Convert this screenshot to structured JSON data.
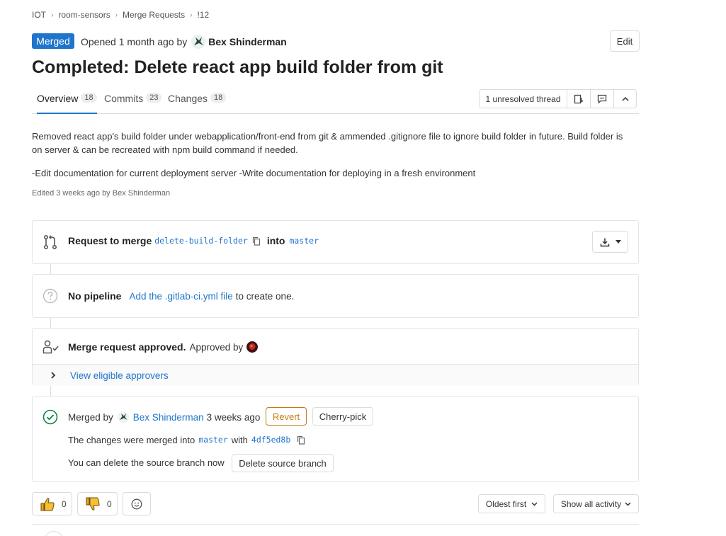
{
  "breadcrumb": {
    "items": [
      "IOT",
      "room-sensors",
      "Merge Requests",
      "!12"
    ]
  },
  "header": {
    "status": "Merged",
    "opened_text": "Opened",
    "opened_time": "1 month ago",
    "by_text": "by",
    "author": "Bex Shinderman",
    "edit_label": "Edit",
    "title": "Completed: Delete react app build folder from git"
  },
  "tabs": [
    {
      "label": "Overview",
      "count": "18"
    },
    {
      "label": "Commits",
      "count": "23"
    },
    {
      "label": "Changes",
      "count": "18"
    }
  ],
  "threads": {
    "unresolved_label": "1 unresolved thread"
  },
  "description": {
    "para1": "Removed react app's build folder under webapplication/front-end from git & ammended .gitignore file to ignore build folder in future. Build folder is on server & can be recreated with npm build command if needed.",
    "para2": "-Edit documentation for current deployment server -Write documentation for deploying in a fresh environment",
    "edited": "Edited 3 weeks ago by Bex Shinderman"
  },
  "merge_widget": {
    "request_label": "Request to merge",
    "source_branch": "delete-build-folder",
    "into_label": "into",
    "target_branch": "master"
  },
  "pipeline": {
    "status_label": "No pipeline",
    "link_label": "Add the .gitlab-ci.yml file",
    "suffix": "to create one."
  },
  "approvals": {
    "label": "Merge request approved.",
    "approved_by": "Approved by",
    "view_label": "View eligible approvers"
  },
  "merged": {
    "merged_by": "Merged by",
    "author": "Bex Shinderman",
    "time": "3 weeks ago",
    "revert_label": "Revert",
    "cherry_pick_label": "Cherry-pick",
    "changes_text": "The changes were merged into",
    "target_branch": "master",
    "with_text": "with",
    "commit_sha": "4df5ed8b",
    "delete_text": "You can delete the source branch now",
    "delete_button": "Delete source branch"
  },
  "reactions": {
    "thumbs_up_count": "0",
    "thumbs_down_count": "0"
  },
  "activity": {
    "sort_label": "Oldest first",
    "filter_label": "Show all activity"
  },
  "colors": {
    "merged_badge": "#1f75cb",
    "success": "#108548",
    "revert": "#c17d10",
    "link": "#1f75cb"
  }
}
